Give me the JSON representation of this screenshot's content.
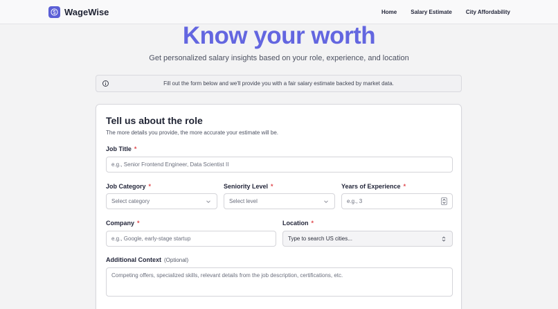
{
  "navbar": {
    "brand": "WageWise",
    "logo_icon": "dollar-coin-icon",
    "links": [
      "Home",
      "Salary Estimate",
      "City Affordability"
    ]
  },
  "hero": {
    "title": "Know your worth",
    "subtitle": "Get personalized salary insights based on your role, experience, and location"
  },
  "info": {
    "icon": "info-circle-icon",
    "text": "Fill out the form below and we'll provide you with a fair salary estimate backed by market data."
  },
  "form": {
    "title": "Tell us about the role",
    "subtitle": "The more details you provide, the more accurate your estimate will be.",
    "required_marker": "*",
    "job_title": {
      "label": "Job Title",
      "placeholder": "e.g., Senior Frontend Engineer, Data Scientist II"
    },
    "job_category": {
      "label": "Job Category",
      "placeholder": "Select category"
    },
    "seniority": {
      "label": "Seniority Level",
      "placeholder": "Select level"
    },
    "experience": {
      "label": "Years of Experience",
      "placeholder": "e.g., 3"
    },
    "company": {
      "label": "Company",
      "placeholder": "e.g., Google, early-stage startup"
    },
    "location": {
      "label": "Location",
      "placeholder": "Type to search US cities..."
    },
    "context": {
      "label": "Additional Context",
      "optional": "(Optional)",
      "placeholder": "Competing offers, specialized skills, relevant details from the job description, certifications, etc."
    }
  },
  "colors": {
    "accent": "#6366e0",
    "brand": "#5b5fd6",
    "required": "#e0484d",
    "background": "#f3f3f4"
  }
}
